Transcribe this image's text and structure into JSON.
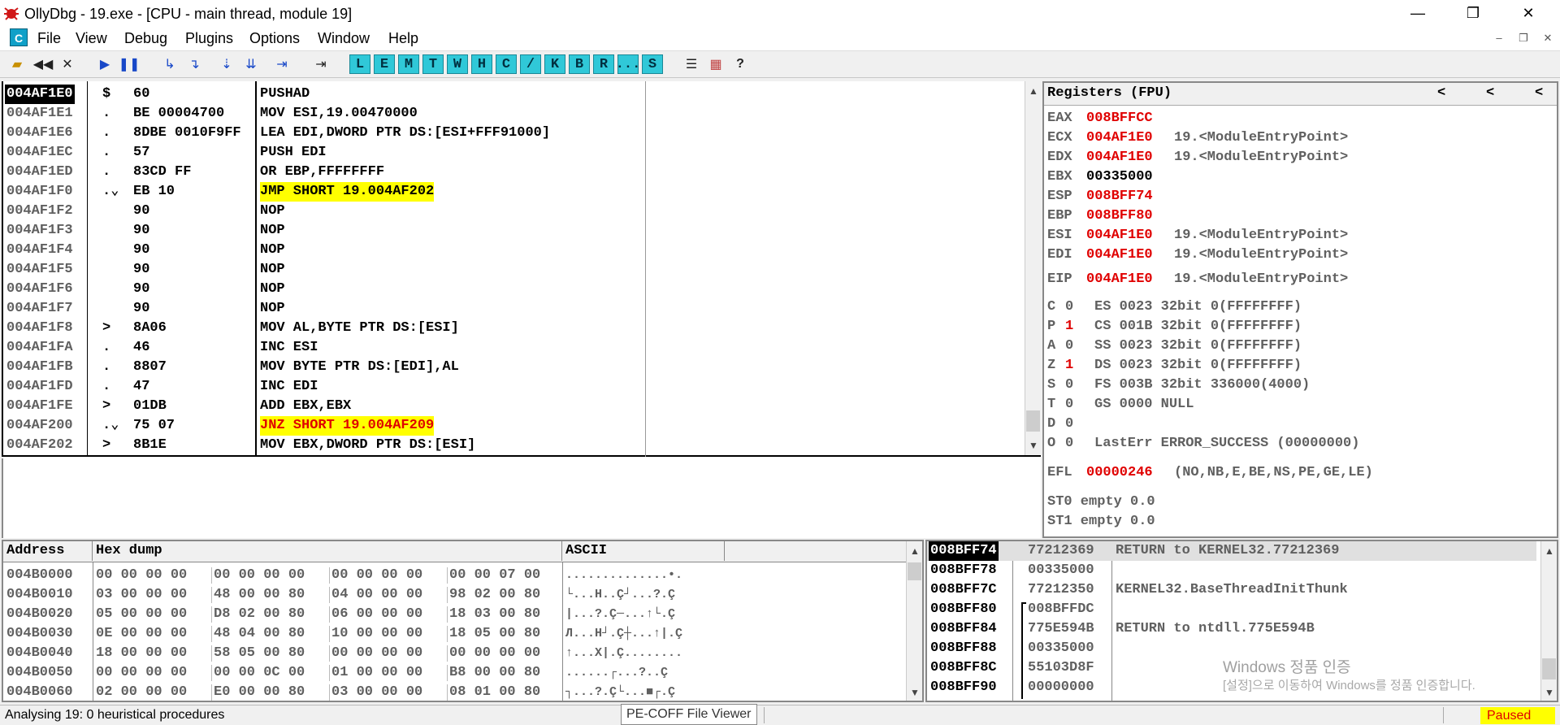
{
  "window": {
    "title": "OllyDbg - 19.exe - [CPU - main thread, module 19]",
    "minimize": "—",
    "restore": "❐",
    "close": "✕"
  },
  "menu": {
    "app_icon": "C",
    "items": [
      "File",
      "View",
      "Debug",
      "Plugins",
      "Options",
      "Window",
      "Help"
    ],
    "mdi_min": "–",
    "mdi_restore": "❐",
    "mdi_close": "✕"
  },
  "toolbar": {
    "letters": [
      "L",
      "E",
      "M",
      "T",
      "W",
      "H",
      "C",
      "/",
      "K",
      "B",
      "R",
      "...",
      "S"
    ],
    "question": "?"
  },
  "disasm": {
    "rows": [
      {
        "addr": "004AF1E0",
        "mark": "$",
        "hex": "60",
        "instr": "PUSHAD",
        "style": "sel"
      },
      {
        "addr": "004AF1E1",
        "mark": ".",
        "hex": "BE 00004700",
        "instr": "MOV ESI,19.00470000",
        "style": ""
      },
      {
        "addr": "004AF1E6",
        "mark": ".",
        "hex": "8DBE 0010F9FF",
        "instr": "LEA EDI,DWORD PTR DS:[ESI+FFF91000]",
        "style": ""
      },
      {
        "addr": "004AF1EC",
        "mark": ".",
        "hex": "57",
        "instr": "PUSH EDI",
        "style": ""
      },
      {
        "addr": "004AF1ED",
        "mark": ".",
        "hex": "83CD FF",
        "instr": "OR EBP,FFFFFFFF",
        "style": ""
      },
      {
        "addr": "004AF1F0",
        "mark": ".⌄",
        "hex": "EB 10",
        "instr": "JMP SHORT 19.004AF202",
        "style": "jmp"
      },
      {
        "addr": "004AF1F2",
        "mark": "",
        "hex": "90",
        "instr": "NOP",
        "style": ""
      },
      {
        "addr": "004AF1F3",
        "mark": "",
        "hex": "90",
        "instr": "NOP",
        "style": ""
      },
      {
        "addr": "004AF1F4",
        "mark": "",
        "hex": "90",
        "instr": "NOP",
        "style": ""
      },
      {
        "addr": "004AF1F5",
        "mark": "",
        "hex": "90",
        "instr": "NOP",
        "style": ""
      },
      {
        "addr": "004AF1F6",
        "mark": "",
        "hex": "90",
        "instr": "NOP",
        "style": ""
      },
      {
        "addr": "004AF1F7",
        "mark": "",
        "hex": "90",
        "instr": "NOP",
        "style": ""
      },
      {
        "addr": "004AF1F8",
        "mark": ">",
        "hex": "8A06",
        "instr": "MOV AL,BYTE PTR DS:[ESI]",
        "style": ""
      },
      {
        "addr": "004AF1FA",
        "mark": ".",
        "hex": "46",
        "instr": "INC ESI",
        "style": ""
      },
      {
        "addr": "004AF1FB",
        "mark": ".",
        "hex": "8807",
        "instr": "MOV BYTE PTR DS:[EDI],AL",
        "style": ""
      },
      {
        "addr": "004AF1FD",
        "mark": ".",
        "hex": "47",
        "instr": "INC EDI",
        "style": ""
      },
      {
        "addr": "004AF1FE",
        "mark": ">",
        "hex": "01DB",
        "instr": "ADD EBX,EBX",
        "style": ""
      },
      {
        "addr": "004AF200",
        "mark": ".⌄",
        "hex": "75 07",
        "instr": "JNZ SHORT 19.004AF209",
        "style": "jcc"
      },
      {
        "addr": "004AF202",
        "mark": ">",
        "hex": "8B1E",
        "instr": "MOV EBX,DWORD PTR DS:[ESI]",
        "style": ""
      }
    ]
  },
  "registers": {
    "title": "Registers (FPU)",
    "nav": [
      "<",
      "<",
      "<"
    ],
    "gp": [
      {
        "name": "EAX",
        "val": "008BFFCC",
        "red": true,
        "comment": ""
      },
      {
        "name": "ECX",
        "val": "004AF1E0",
        "red": true,
        "comment": "19.<ModuleEntryPoint>"
      },
      {
        "name": "EDX",
        "val": "004AF1E0",
        "red": true,
        "comment": "19.<ModuleEntryPoint>"
      },
      {
        "name": "EBX",
        "val": "00335000",
        "red": false,
        "comment": ""
      },
      {
        "name": "ESP",
        "val": "008BFF74",
        "red": true,
        "comment": ""
      },
      {
        "name": "EBP",
        "val": "008BFF80",
        "red": true,
        "comment": ""
      },
      {
        "name": "ESI",
        "val": "004AF1E0",
        "red": true,
        "comment": "19.<ModuleEntryPoint>"
      },
      {
        "name": "EDI",
        "val": "004AF1E0",
        "red": true,
        "comment": "19.<ModuleEntryPoint>"
      }
    ],
    "eip": {
      "name": "EIP",
      "val": "004AF1E0",
      "comment": "19.<ModuleEntryPoint>"
    },
    "flags": [
      {
        "f": "C",
        "v": "0",
        "red": false,
        "seg": "ES 0023 32bit 0(FFFFFFFF)"
      },
      {
        "f": "P",
        "v": "1",
        "red": true,
        "seg": "CS 001B 32bit 0(FFFFFFFF)"
      },
      {
        "f": "A",
        "v": "0",
        "red": false,
        "seg": "SS 0023 32bit 0(FFFFFFFF)"
      },
      {
        "f": "Z",
        "v": "1",
        "red": true,
        "seg": "DS 0023 32bit 0(FFFFFFFF)"
      },
      {
        "f": "S",
        "v": "0",
        "red": false,
        "seg": "FS 003B 32bit 336000(4000)"
      },
      {
        "f": "T",
        "v": "0",
        "red": false,
        "seg": "GS 0000 NULL"
      },
      {
        "f": "D",
        "v": "0",
        "red": false,
        "seg": ""
      },
      {
        "f": "O",
        "v": "0",
        "red": false,
        "seg": "LastErr ERROR_SUCCESS (00000000)"
      }
    ],
    "efl": {
      "name": "EFL",
      "val": "00000246",
      "comment": "(NO,NB,E,BE,NS,PE,GE,LE)"
    },
    "fpu": [
      "ST0 empty 0.0",
      "ST1 empty 0.0"
    ]
  },
  "dump": {
    "headers": {
      "address": "Address",
      "hex": "Hex dump",
      "ascii": "ASCII"
    },
    "rows": [
      {
        "addr": "004B0000",
        "hex": [
          "00 00 00 00",
          "00 00 00 00",
          "00 00 00 00",
          "00 00 07 00"
        ],
        "ascii": "..............•."
      },
      {
        "addr": "004B0010",
        "hex": [
          "03 00 00 00",
          "48 00 00 80",
          "04 00 00 00",
          "98 02 00 80"
        ],
        "ascii": "└...H..Ç┘...?.Ç"
      },
      {
        "addr": "004B0020",
        "hex": [
          "05 00 00 00",
          "D8 02 00 80",
          "06 00 00 00",
          "18 03 00 80"
        ],
        "ascii": "|...?.Ç─...↑└.Ç"
      },
      {
        "addr": "004B0030",
        "hex": [
          "0E 00 00 00",
          "48 04 00 80",
          "10 00 00 00",
          "18 05 00 80"
        ],
        "ascii": "Л...H┘.Ç┼...↑|.Ç"
      },
      {
        "addr": "004B0040",
        "hex": [
          "18 00 00 00",
          "58 05 00 80",
          "00 00 00 00",
          "00 00 00 00"
        ],
        "ascii": "↑...X|.Ç........"
      },
      {
        "addr": "004B0050",
        "hex": [
          "00 00 00 00",
          "00 00 0C 00",
          "01 00 00 00",
          "B8 00 00 80"
        ],
        "ascii": "......┌...?..Ç"
      },
      {
        "addr": "004B0060",
        "hex": [
          "02 00 00 00",
          "E0 00 00 80",
          "03 00 00 00",
          "08 01 00 80"
        ],
        "ascii": "┐...?.Ç└...■┌.Ç"
      }
    ]
  },
  "stack": {
    "rows": [
      {
        "addr": "008BFF74",
        "val": "77212369",
        "comment": "RETURN to KERNEL32.77212369",
        "sel": true
      },
      {
        "addr": "008BFF78",
        "val": "00335000",
        "comment": "",
        "sel": false
      },
      {
        "addr": "008BFF7C",
        "val": "77212350",
        "comment": "KERNEL32.BaseThreadInitThunk",
        "sel": false
      },
      {
        "addr": "008BFF80",
        "val": "008BFFDC",
        "comment": "",
        "sel": false
      },
      {
        "addr": "008BFF84",
        "val": "775E594B",
        "comment": "RETURN to ntdll.775E594B",
        "sel": false
      },
      {
        "addr": "008BFF88",
        "val": "00335000",
        "comment": "",
        "sel": false
      },
      {
        "addr": "008BFF8C",
        "val": "55103D8F",
        "comment": "",
        "sel": false
      },
      {
        "addr": "008BFF90",
        "val": "00000000",
        "comment": "",
        "sel": false
      }
    ]
  },
  "watermark": {
    "line1": "Windows 정품 인증",
    "line2": "[설정]으로 이동하여 Windows를 정품 인증합니다."
  },
  "status": {
    "text": "Analysing 19: 0 heuristical procedures",
    "tooltip": "PE-COFF File Viewer",
    "state": "Paused"
  }
}
